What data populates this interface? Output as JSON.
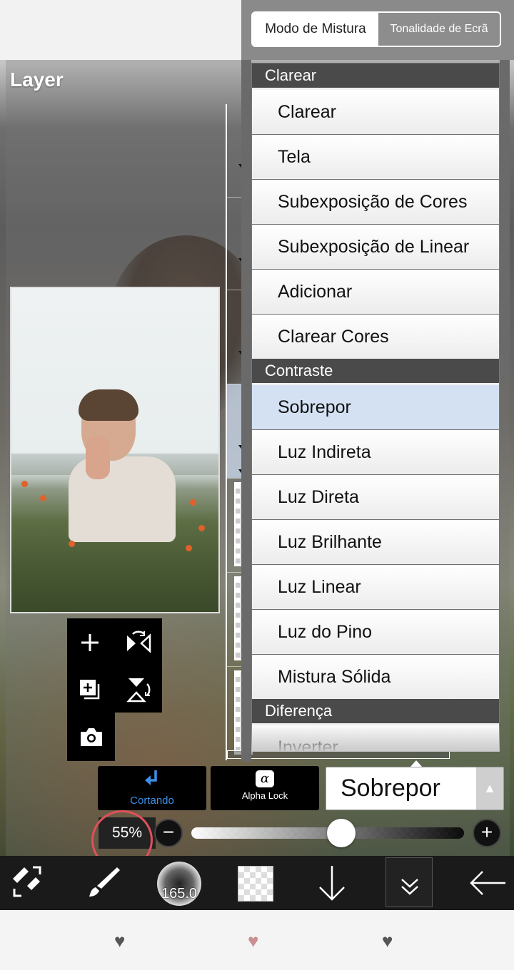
{
  "panel": {
    "title": "Layer"
  },
  "blend_panel": {
    "tabs": [
      {
        "label": "Modo de Mistura",
        "active": true
      },
      {
        "label": "Tonalidade de Ecrã",
        "active": false
      }
    ],
    "groups": [
      {
        "header": "Clarear"
      },
      {
        "header": "Contraste"
      },
      {
        "header": "Diferença"
      }
    ],
    "items": [
      {
        "label": "Clarear"
      },
      {
        "label": "Tela"
      },
      {
        "label": "Subexposição de Cores"
      },
      {
        "label": "Subexposição de Linear"
      },
      {
        "label": "Adicionar"
      },
      {
        "label": "Clarear Cores"
      },
      {
        "label": "Sobrepor",
        "selected": true
      },
      {
        "label": "Luz Indireta"
      },
      {
        "label": "Luz Direta"
      },
      {
        "label": "Luz Brilhante"
      },
      {
        "label": "Luz Linear"
      },
      {
        "label": "Luz do Pino"
      },
      {
        "label": "Mistura Sólida"
      },
      {
        "label": "Inverter"
      }
    ]
  },
  "controls": {
    "clipping_label": "Cortando",
    "alpha_lock_label": "Alpha Lock",
    "alpha_icon": "α",
    "blend_selected": "Sobrepor",
    "opacity_text": "55%",
    "opacity_value": 0.55,
    "minus": "−",
    "plus": "+"
  },
  "toolbar": {
    "brush_size": "165.0"
  },
  "icons": {
    "tool_add": "plus-icon",
    "tool_flip_h": "flip-horizontal-icon",
    "tool_add_copy": "add-layer-icon",
    "tool_flip_v": "flip-vertical-icon",
    "tool_camera": "camera-icon"
  },
  "colors": {
    "accent_blue": "#3b8fe8",
    "selected_row": "#d3e1f3",
    "group_header": "#4a4a4a",
    "annotation_red": "#e0505a"
  }
}
